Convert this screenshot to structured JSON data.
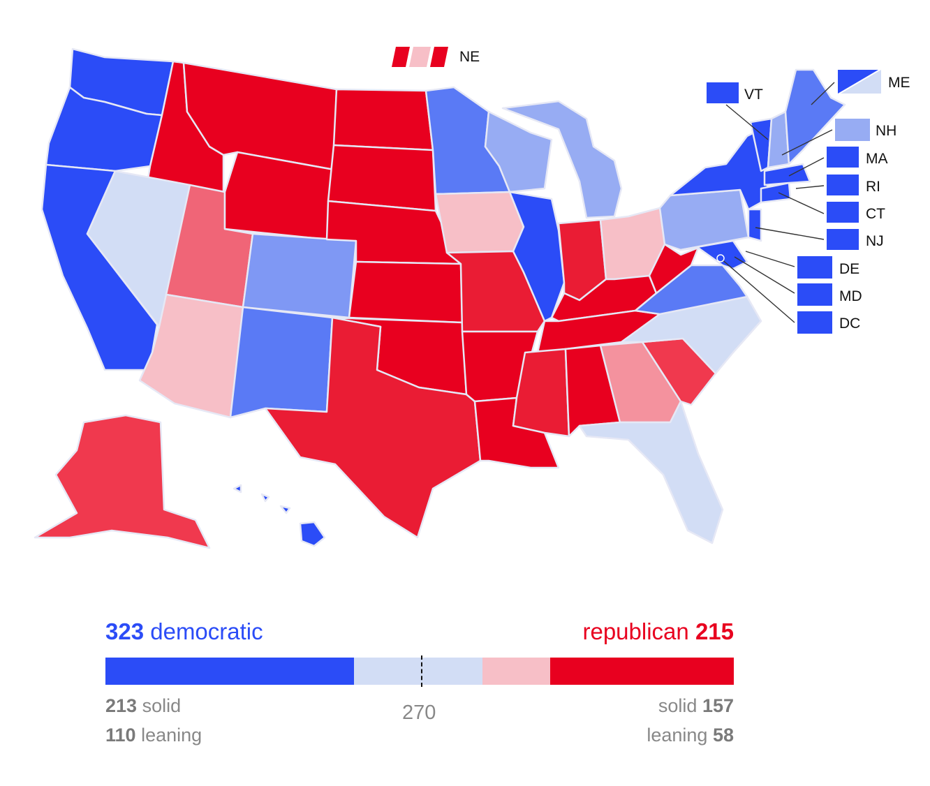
{
  "palette": {
    "solid_dem": "#2b4cf7",
    "likely_dem": "#5a7af5",
    "lean_dem": "#97acf3",
    "tossup": "#d2ddf5",
    "lean_rep": "#f7bfc7",
    "likely_rep": "#f06577",
    "strong_rep": "#ea1c34",
    "solid_rep": "#e8001f"
  },
  "small_states": [
    {
      "label": "VT",
      "rating": "solid_dem"
    },
    {
      "label": "ME",
      "rating": "split_me"
    },
    {
      "label": "NH",
      "rating": "lean_dem"
    },
    {
      "label": "MA",
      "rating": "solid_dem"
    },
    {
      "label": "RI",
      "rating": "solid_dem"
    },
    {
      "label": "CT",
      "rating": "solid_dem"
    },
    {
      "label": "NJ",
      "rating": "solid_dem"
    },
    {
      "label": "DE",
      "rating": "solid_dem"
    },
    {
      "label": "MD",
      "rating": "solid_dem"
    },
    {
      "label": "DC",
      "rating": "solid_dem"
    },
    {
      "label": "NE",
      "rating": "split_ne"
    }
  ],
  "summary": {
    "dem_total": "323",
    "dem_name": "democratic",
    "rep_name": "republican",
    "rep_total": "215",
    "dem_solid": "213",
    "dem_solid_label": "solid",
    "dem_leaning": "110",
    "dem_leaning_label": "leaning",
    "rep_solid_label": "solid",
    "rep_solid": "157",
    "rep_leaning_label": "leaning",
    "rep_leaning": "58",
    "threshold": "270"
  },
  "bar_segments": [
    {
      "color": "#2b4cf7",
      "value": 213
    },
    {
      "color": "#d2ddf5",
      "value": 110
    },
    {
      "color": "#f7bfc7",
      "value": 58
    },
    {
      "color": "#e8001f",
      "value": 157
    }
  ],
  "bar_total": 538,
  "bar_threshold": 270
}
